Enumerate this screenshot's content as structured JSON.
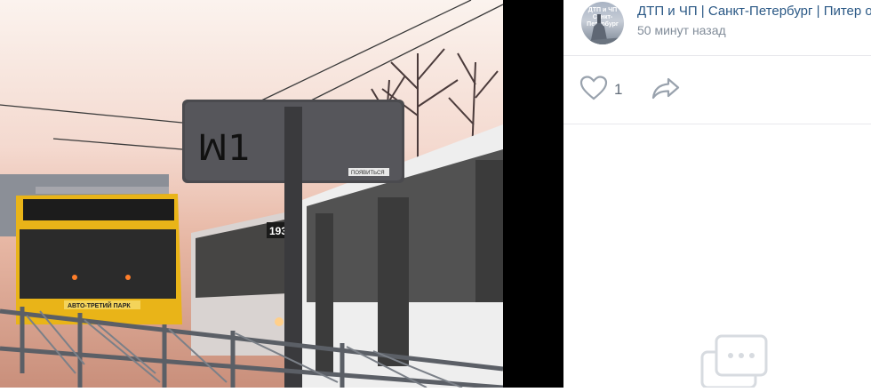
{
  "post": {
    "group_name": "ДТП и ЧП | Санкт-Петербург | Питер онлайн | СПб",
    "time": "50 минут назад",
    "avatar_text": "ДТП и ЧП Санкт-Петербург"
  },
  "actions": {
    "likes_count": "1"
  },
  "photo": {
    "route_number": "193",
    "bus_banner": "АВТО-ТРЕТИЙ ПАРК",
    "sign_sticker": "ПОЯВИТЬСЯ",
    "sign_graffiti": "ꟽ1"
  },
  "colors": {
    "link": "#2a5885",
    "meta": "#818c99",
    "icon": "#99a2ad",
    "divider": "#e7e8ec"
  }
}
